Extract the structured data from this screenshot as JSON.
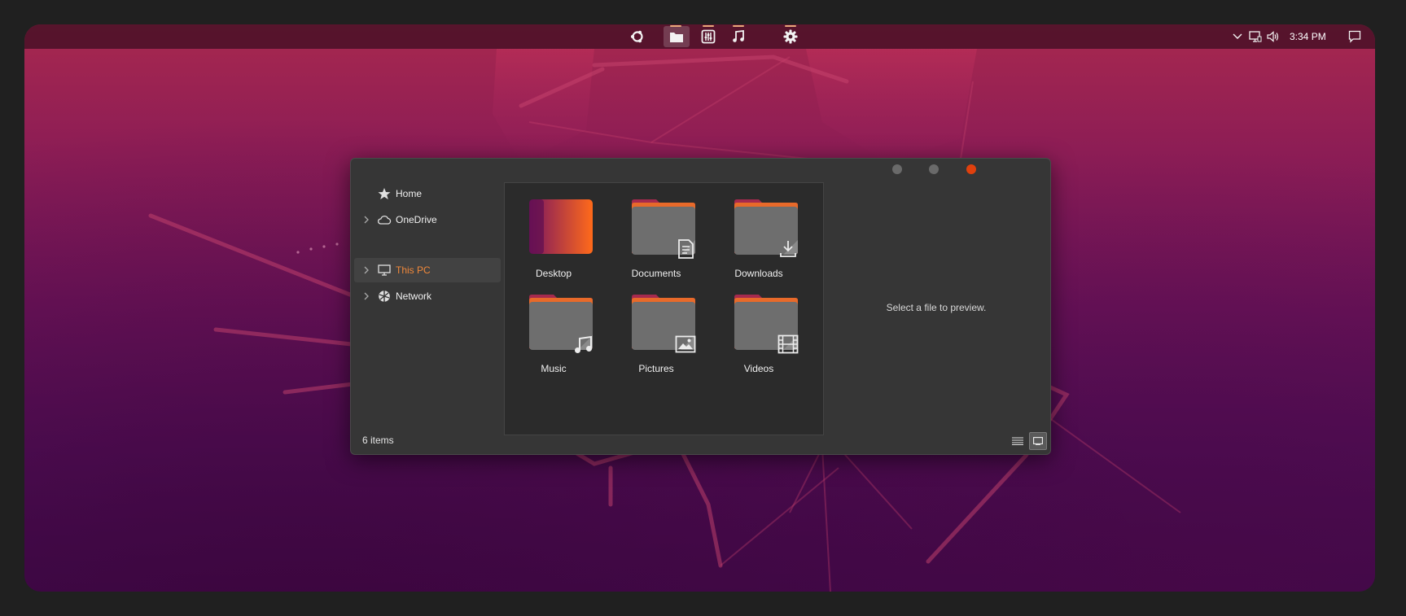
{
  "panel": {
    "dock": [
      {
        "name": "ubuntu-logo-icon",
        "active": false
      },
      {
        "name": "file-explorer-icon",
        "active": true
      },
      {
        "name": "mixer-icon",
        "active": false
      },
      {
        "name": "music-note-icon",
        "active": false
      },
      {
        "name": "settings-gear-icon",
        "active": false
      }
    ],
    "clock": "3:34 PM",
    "tray_icons": [
      "chevron-down-icon",
      "network-icon",
      "volume-icon",
      "notification-icon"
    ]
  },
  "window": {
    "controls": [
      "minimize-button",
      "maximize-button",
      "close-button"
    ],
    "colors": {
      "accent": "#f0883a",
      "close": "#e0400d",
      "background": "#363636"
    },
    "sidebar": {
      "items": [
        {
          "label": "Home",
          "icon": "star-icon",
          "expandable": false,
          "selected": false
        },
        {
          "label": "OneDrive",
          "icon": "cloud-icon",
          "expandable": true,
          "selected": false
        },
        {
          "label": "This PC",
          "icon": "monitor-icon",
          "expandable": true,
          "selected": true
        },
        {
          "label": "Network",
          "icon": "network-globe-icon",
          "expandable": true,
          "selected": false
        }
      ]
    },
    "folders": [
      {
        "label": "Desktop",
        "icon": "desktop-folder-icon"
      },
      {
        "label": "Documents",
        "icon": "document-icon"
      },
      {
        "label": "Downloads",
        "icon": "download-icon"
      },
      {
        "label": "Music",
        "icon": "music-note-icon"
      },
      {
        "label": "Pictures",
        "icon": "picture-icon"
      },
      {
        "label": "Videos",
        "icon": "film-icon"
      }
    ],
    "preview_text": "Select a file to preview.",
    "status": "6 items",
    "view_modes": [
      {
        "name": "details-view",
        "active": false
      },
      {
        "name": "preview-pane",
        "active": true
      }
    ]
  }
}
